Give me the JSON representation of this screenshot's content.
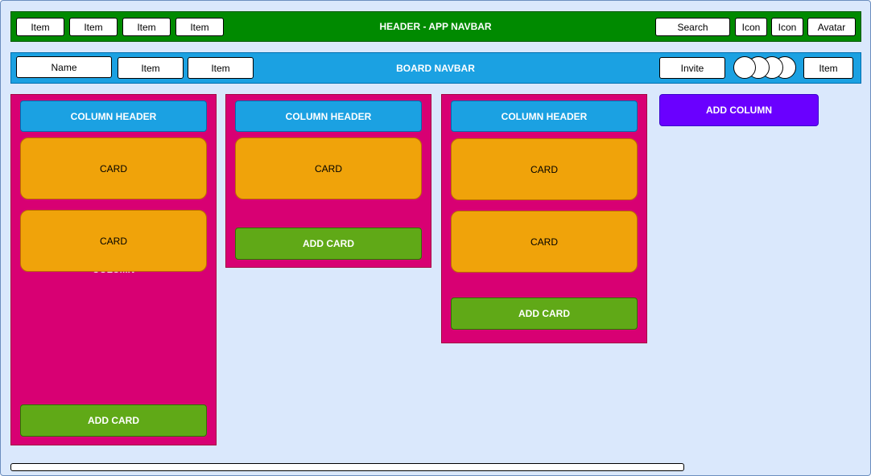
{
  "header": {
    "title": "HEADER - APP NAVBAR",
    "left_items": [
      "Item",
      "Item",
      "Item",
      "Item"
    ],
    "search": "Search",
    "icon1": "Icon",
    "icon2": "Icon",
    "avatar": "Avatar"
  },
  "board": {
    "title": "BOARD NAVBAR",
    "name": "Name",
    "item1": "Item",
    "item2": "Item",
    "invite": "Invite",
    "item_right": "Item"
  },
  "columns": [
    {
      "header": "COLUMN HEADER",
      "label": "COLUMN",
      "cards": [
        "CARD",
        "CARD"
      ],
      "add_card": "ADD CARD"
    },
    {
      "header": "COLUMN HEADER",
      "cards": [
        "CARD"
      ],
      "add_card": "ADD CARD"
    },
    {
      "header": "COLUMN HEADER",
      "cards": [
        "CARD",
        "CARD"
      ],
      "add_card": "ADD CARD"
    }
  ],
  "add_column": "ADD COLUMN",
  "colors": {
    "canvas": "#dae8fc",
    "header_bar": "#008a00",
    "board_bar": "#1ba1e2",
    "column": "#d80073",
    "card": "#f0a30a",
    "add_card": "#60a917",
    "add_column": "#6a00ff"
  }
}
